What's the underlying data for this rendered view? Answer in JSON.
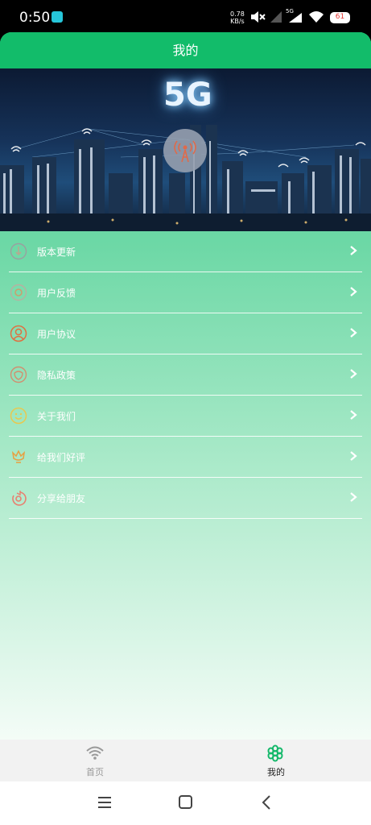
{
  "status_bar": {
    "time": "0:50",
    "net_speed_value": "0.78",
    "net_speed_unit": "KB/s",
    "signal_label": "5G",
    "battery": "61",
    "icons": [
      "app-notification-icon",
      "mute-icon",
      "signal-icon",
      "signal-5g-icon",
      "wifi-icon",
      "battery-icon"
    ]
  },
  "header": {
    "title": "我的"
  },
  "banner": {
    "text": "5G",
    "icon": "radio-tower-icon"
  },
  "menu": {
    "items": [
      {
        "label": "版本更新",
        "icon": "update-icon",
        "color": "#9aa0a0"
      },
      {
        "label": "用户反馈",
        "icon": "feedback-icon",
        "color": "#b8b0a0"
      },
      {
        "label": "用户协议",
        "icon": "user-agreement-icon",
        "color": "#e07040"
      },
      {
        "label": "隐私政策",
        "icon": "privacy-icon",
        "color": "#d09070"
      },
      {
        "label": "关于我们",
        "icon": "about-icon",
        "color": "#e8c850"
      },
      {
        "label": "给我们好评",
        "icon": "rate-icon",
        "color": "#e8a040"
      },
      {
        "label": "分享给朋友",
        "icon": "share-icon",
        "color": "#e88070"
      }
    ]
  },
  "tabs": [
    {
      "label": "首页",
      "icon": "wifi-icon",
      "active": false
    },
    {
      "label": "我的",
      "icon": "flower-icon",
      "active": true
    }
  ],
  "system_nav": {
    "icons": [
      "menu-icon",
      "home-icon",
      "back-icon"
    ]
  },
  "colors": {
    "accent": "#12bc6a",
    "tab_active": "#14b86a",
    "tab_inactive": "#999999"
  }
}
